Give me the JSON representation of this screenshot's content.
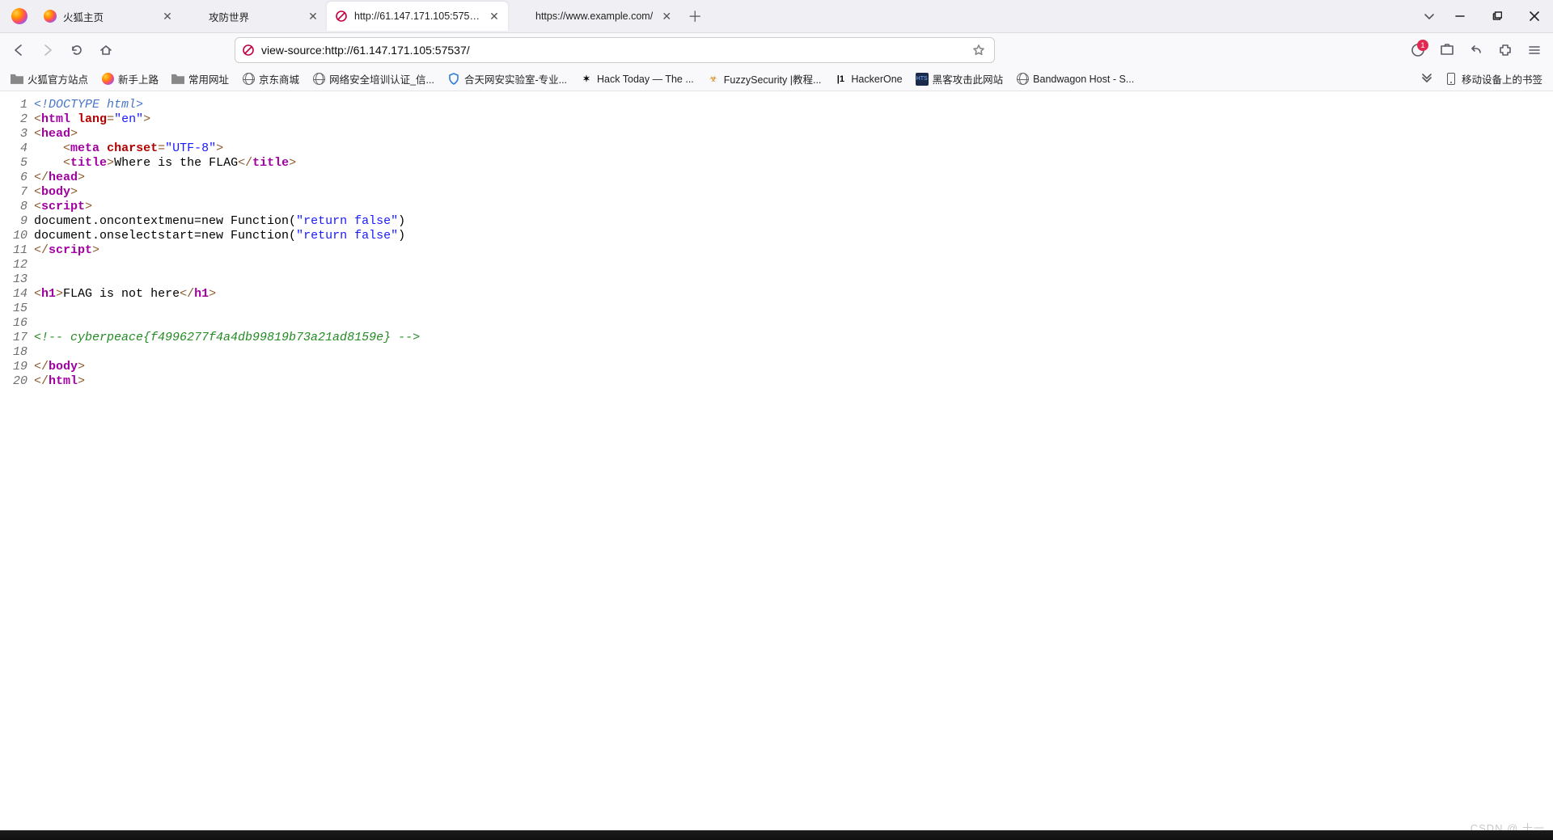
{
  "tabs": [
    {
      "title": "火狐主页",
      "favicon": "firefox",
      "close": true
    },
    {
      "title": "攻防世界",
      "favicon": "none",
      "close": true
    },
    {
      "title": "http://61.147.171.105:57537/",
      "favicon": "blocked",
      "close": true,
      "active": true
    },
    {
      "title": "https://www.example.com/",
      "favicon": "none",
      "close": true
    }
  ],
  "address": {
    "url": "view-source:http://61.147.171.105:57537/",
    "identity": "blocked"
  },
  "toolbar": {
    "notification_count": "1"
  },
  "bookmarks": [
    {
      "label": "火狐官方站点",
      "icon": "folder"
    },
    {
      "label": "新手上路",
      "icon": "firefox"
    },
    {
      "label": "常用网址",
      "icon": "folder"
    },
    {
      "label": "京东商城",
      "icon": "globe"
    },
    {
      "label": "网络安全培训认证_信...",
      "icon": "globe"
    },
    {
      "label": "合天网安实验室-专业...",
      "icon": "shield"
    },
    {
      "label": "Hack Today — The ...",
      "icon": "asterisk"
    },
    {
      "label": "FuzzySecurity |教程...",
      "icon": "bug"
    },
    {
      "label": "HackerOne",
      "icon": "h1"
    },
    {
      "label": "黑客攻击此网站",
      "icon": "hts"
    },
    {
      "label": "Bandwagon Host - S...",
      "icon": "globe"
    }
  ],
  "bookmarks_tail": {
    "label": "移动设备上的书签",
    "icon": "mobile"
  },
  "source_lines": {
    "numbers": [
      "1",
      "2",
      "3",
      "4",
      "5",
      "6",
      "7",
      "8",
      "9",
      "10",
      "11",
      "12",
      "13",
      "14",
      "15",
      "16",
      "17",
      "18",
      "19",
      "20"
    ],
    "l1": "<!DOCTYPE html>",
    "l2_attr_name": "lang",
    "l2_attr_val": "\"en\"",
    "l3_tag": "head",
    "l4_attr_name": "charset",
    "l4_attr_val": "\"UTF-8\"",
    "l5_text": "Where is the FLAG",
    "l7_tag": "body",
    "l8_tag": "script",
    "l9": "document.oncontextmenu=new Function(",
    "l9_str": "\"return false\"",
    "l9_tail": ")",
    "l10": "document.onselectstart=new Function(",
    "l10_str": "\"return false\"",
    "l10_tail": ")",
    "l14_text": "FLAG is not here",
    "l17": "<!-- cyberpeace{f4996277f4a4db99819b73a21ad8159e} -->"
  },
  "watermark": "CSDN @ 十一"
}
